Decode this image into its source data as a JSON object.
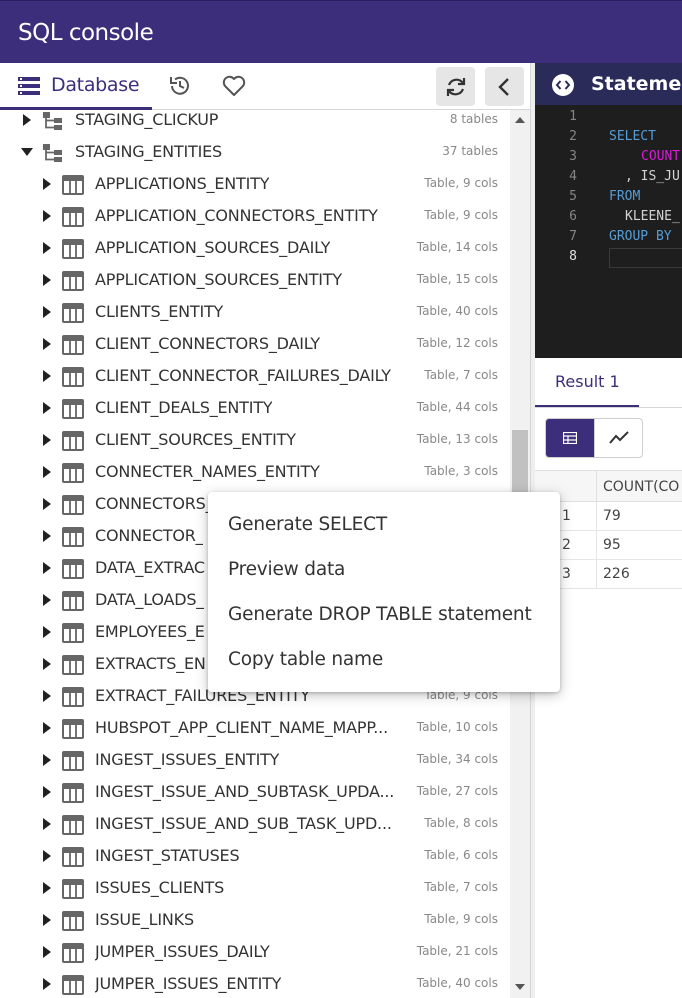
{
  "app": {
    "title": "SQL console"
  },
  "toolbar": {
    "database_tab": "Database",
    "icons": [
      "database-icon",
      "history-icon",
      "heart-icon",
      "refresh-icon",
      "chevron-left-icon"
    ]
  },
  "tree": {
    "schemas": [
      {
        "name": "STAGING_CLICKUP",
        "meta": "8 tables",
        "expanded": false
      },
      {
        "name": "STAGING_ENTITIES",
        "meta": "37 tables",
        "expanded": true
      }
    ],
    "tables": [
      {
        "name": "APPLICATIONS_ENTITY",
        "meta": "Table, 9 cols"
      },
      {
        "name": "APPLICATION_CONNECTORS_ENTITY",
        "meta": "Table, 9 cols"
      },
      {
        "name": "APPLICATION_SOURCES_DAILY",
        "meta": "Table, 14 cols"
      },
      {
        "name": "APPLICATION_SOURCES_ENTITY",
        "meta": "Table, 15 cols"
      },
      {
        "name": "CLIENTS_ENTITY",
        "meta": "Table, 40 cols"
      },
      {
        "name": "CLIENT_CONNECTORS_DAILY",
        "meta": "Table, 12 cols"
      },
      {
        "name": "CLIENT_CONNECTOR_FAILURES_DAILY",
        "meta": "Table, 7 cols"
      },
      {
        "name": "CLIENT_DEALS_ENTITY",
        "meta": "Table, 44 cols"
      },
      {
        "name": "CLIENT_SOURCES_ENTITY",
        "meta": "Table, 13 cols"
      },
      {
        "name": "CONNECTER_NAMES_ENTITY",
        "meta": "Table, 3 cols"
      },
      {
        "name": "CONNECTORS_",
        "meta": ""
      },
      {
        "name": "CONNECTOR_",
        "meta": ""
      },
      {
        "name": "DATA_EXTRAC",
        "meta": ""
      },
      {
        "name": "DATA_LOADS_",
        "meta": ""
      },
      {
        "name": "EMPLOYEES_E",
        "meta": ""
      },
      {
        "name": "EXTRACTS_EN",
        "meta": ""
      },
      {
        "name": "EXTRACT_FAILURES_ENTITY",
        "meta": "Table, 9 cols"
      },
      {
        "name": "HUBSPOT_APP_CLIENT_NAME_MAPP...",
        "meta": "Table, 10 cols"
      },
      {
        "name": "INGEST_ISSUES_ENTITY",
        "meta": "Table, 34 cols"
      },
      {
        "name": "INGEST_ISSUE_AND_SUBTASK_UPDA...",
        "meta": "Table, 27 cols"
      },
      {
        "name": "INGEST_ISSUE_AND_SUB_TASK_UPD...",
        "meta": "Table, 8 cols"
      },
      {
        "name": "INGEST_STATUSES",
        "meta": "Table, 6 cols"
      },
      {
        "name": "ISSUES_CLIENTS",
        "meta": "Table, 7 cols"
      },
      {
        "name": "ISSUE_LINKS",
        "meta": "Table, 9 cols"
      },
      {
        "name": "JUMPER_ISSUES_DAILY",
        "meta": "Table, 21 cols"
      },
      {
        "name": "JUMPER_ISSUES_ENTITY",
        "meta": "Table, 40 cols"
      }
    ]
  },
  "context_menu": {
    "items": [
      "Generate SELECT",
      "Preview data",
      "Generate DROP TABLE statement",
      "Copy table name"
    ]
  },
  "statement": {
    "title": "Statement",
    "line_numbers": [
      "1",
      "2",
      "3",
      "4",
      "5",
      "6",
      "7",
      "8"
    ],
    "active_line": "8",
    "code": {
      "l2": "SELECT",
      "l3": "COUNT",
      "l4": ", IS_JU",
      "l5": "FROM",
      "l6": "KLEENE_",
      "l7": "GROUP BY"
    }
  },
  "results": {
    "tab": "Result 1",
    "view_icons": [
      "table-icon",
      "chart-icon"
    ],
    "column": "COUNT(CO",
    "rows": [
      {
        "index": "1",
        "value": "79"
      },
      {
        "index": "2",
        "value": "95"
      },
      {
        "index": "3",
        "value": "226"
      }
    ]
  },
  "colors": {
    "brand": "#3d2e7c",
    "editor_bg": "#1e1e1e",
    "keyword": "#569cd6",
    "function": "#d81bd8"
  }
}
